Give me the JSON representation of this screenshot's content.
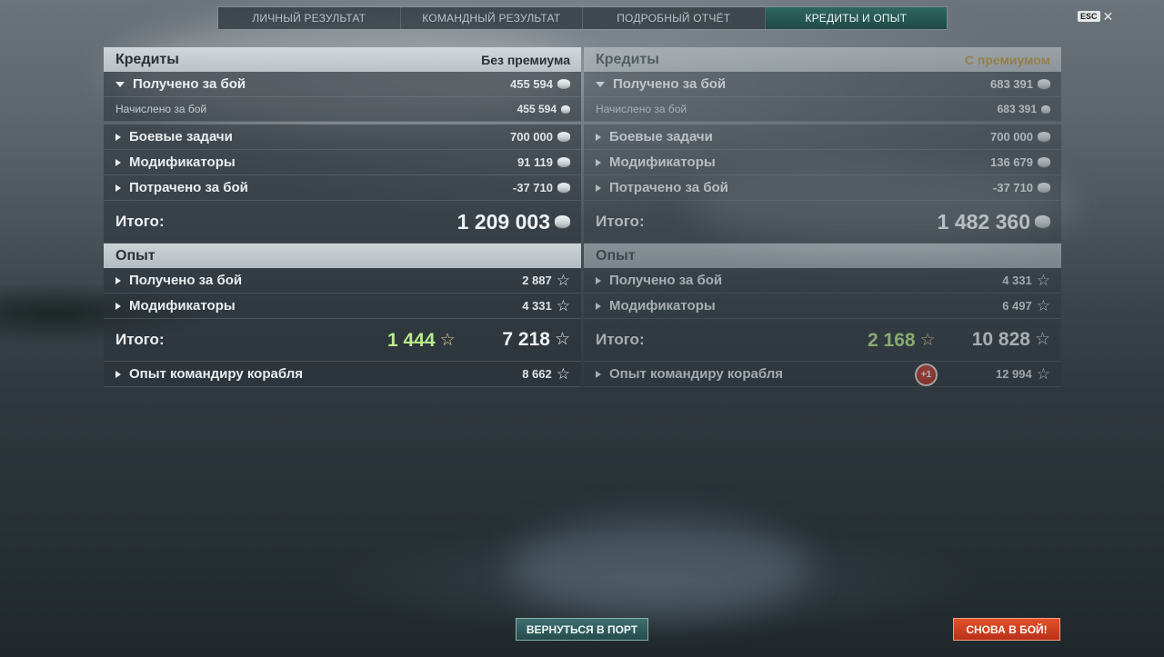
{
  "tabs": [
    {
      "label": "ЛИЧНЫЙ РЕЗУЛЬТАТ",
      "active": false
    },
    {
      "label": "КОМАНДНЫЙ РЕЗУЛЬТАТ",
      "active": false
    },
    {
      "label": "ПОДРОБНЫЙ ОТЧЁТ",
      "active": false
    },
    {
      "label": "КРЕДИТЫ И ОПЫТ",
      "active": true
    }
  ],
  "esc": {
    "key_label": "ESC",
    "close_glyph": "✕"
  },
  "left": {
    "credits_header": "Кредиты",
    "credits_mode": "Без премиума",
    "earned_label": "Получено за бой",
    "earned_value": "455 594",
    "accrued_label": "Начислено за бой",
    "accrued_value": "455 594",
    "missions_label": "Боевые задачи",
    "missions_value": "700 000",
    "modifiers_label": "Модификаторы",
    "modifiers_value": "91 119",
    "spent_label": "Потрачено за бой",
    "spent_value": "-37 710",
    "credits_total_label": "Итого:",
    "credits_total_value": "1 209 003",
    "xp_header": "Опыт",
    "xp_earned_label": "Получено за бой",
    "xp_earned_value": "2 887",
    "xp_modifiers_label": "Модификаторы",
    "xp_modifiers_value": "4 331",
    "xp_total_label": "Итого:",
    "xp_total_free": "1 444",
    "xp_total_value": "7 218",
    "commander_label": "Опыт командиру корабля",
    "commander_value": "8 662"
  },
  "right": {
    "credits_header": "Кредиты",
    "credits_mode": "С премиумом",
    "earned_label": "Получено за бой",
    "earned_value": "683 391",
    "accrued_label": "Начислено за бой",
    "accrued_value": "683 391",
    "missions_label": "Боевые задачи",
    "missions_value": "700 000",
    "modifiers_label": "Модификаторы",
    "modifiers_value": "136 679",
    "spent_label": "Потрачено за бой",
    "spent_value": "-37 710",
    "credits_total_label": "Итого:",
    "credits_total_value": "1 482 360",
    "xp_header": "Опыт",
    "xp_earned_label": "Получено за бой",
    "xp_earned_value": "4 331",
    "xp_modifiers_label": "Модификаторы",
    "xp_modifiers_value": "6 497",
    "xp_total_label": "Итого:",
    "xp_total_free": "2 168",
    "xp_total_value": "10 828",
    "commander_label": "Опыт командиру корабля",
    "commander_value": "12 994",
    "commander_badge": "+1"
  },
  "buttons": {
    "return_to_port": "ВЕРНУТЬСЯ В ПОРТ",
    "battle_again": "СНОВА В БОЙ!"
  },
  "colors": {
    "premium_gold": "#b58a2c",
    "free_xp_green": "#b8ec8c",
    "active_tab": "#2f6660",
    "battle_button": "#e2512a"
  },
  "icons": {
    "credits": "credits-coin-icon",
    "xp": "xp-star-icon",
    "free_xp": "free-xp-star-icon"
  }
}
